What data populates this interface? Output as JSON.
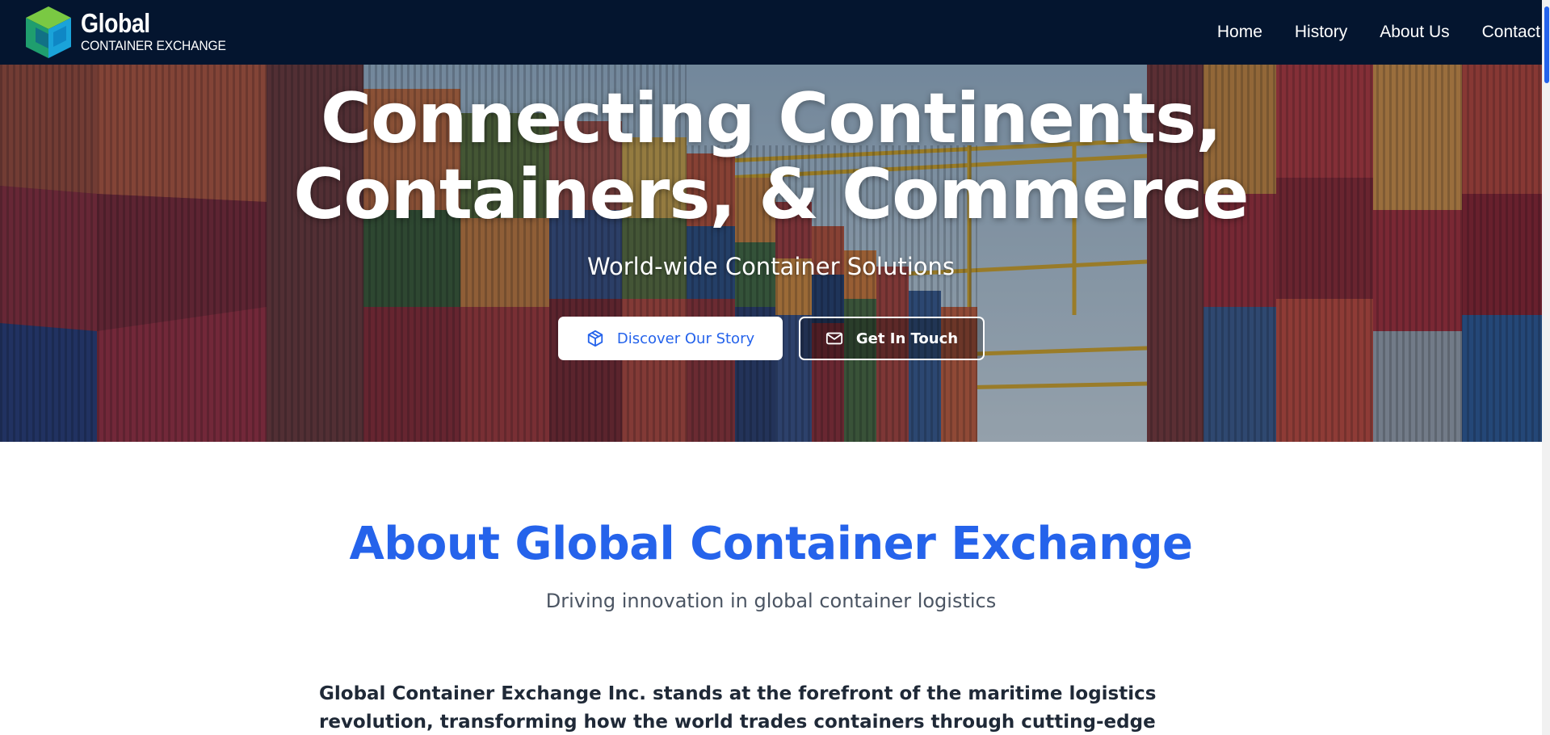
{
  "header": {
    "logo_title": "Global",
    "logo_subtitle": "CONTAINER EXCHANGE",
    "nav": [
      {
        "label": "Home"
      },
      {
        "label": "History"
      },
      {
        "label": "About Us"
      },
      {
        "label": "Contact"
      }
    ],
    "background_color": "#04152f"
  },
  "hero": {
    "title_line1": "Connecting Continents,",
    "title_line2": "Containers, & Commerce",
    "subtitle": "World-wide Container Solutions",
    "primary_button": {
      "label": "Discover Our Story",
      "icon": "box-icon"
    },
    "secondary_button": {
      "label": "Get In Touch",
      "icon": "mail-icon"
    }
  },
  "about": {
    "title": "About Global Container Exchange",
    "subtitle": "Driving innovation in global container logistics",
    "body": "Global Container Exchange Inc. stands at the forefront of the maritime logistics revolution, transforming how the world trades containers through cutting-edge digital innovation and"
  },
  "colors": {
    "accent": "#2563eb",
    "text_dark": "#1f2937",
    "text_muted": "#4b5563"
  }
}
